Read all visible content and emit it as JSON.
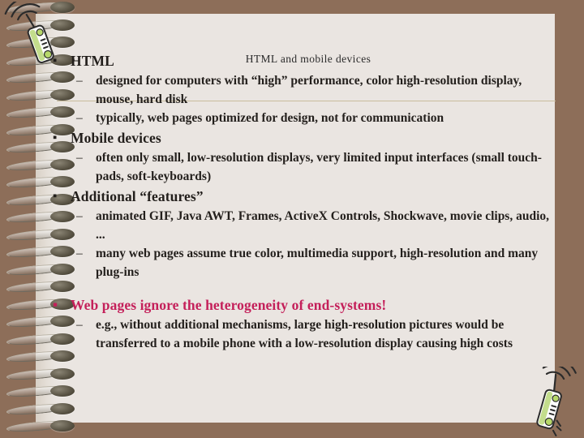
{
  "slide": {
    "title": "HTML and mobile devices",
    "colors": {
      "page_background": "#EAE5E1",
      "border_brown": "#8D6E59",
      "body_text": "#231F1C",
      "accent_text": "#C4205A",
      "rule": "#C9BC9C"
    },
    "markers": {
      "level1": "▪",
      "level2": "–"
    },
    "bullets": [
      {
        "level": 1,
        "text": "HTML",
        "accent": false
      },
      {
        "level": 2,
        "text": "designed for computers with “high” performance, color high-resolution display, mouse, hard disk",
        "accent": false
      },
      {
        "level": 2,
        "text": "typically, web pages optimized for design, not for communication",
        "accent": false
      },
      {
        "level": 1,
        "text": "Mobile devices",
        "accent": false
      },
      {
        "level": 2,
        "text": "often only small, low-resolution displays, very limited input interfaces (small touch-pads, soft-keyboards)",
        "accent": false
      },
      {
        "level": 1,
        "text": "Additional “features”",
        "accent": false
      },
      {
        "level": 2,
        "text": "animated GIF, Java AWT, Frames, ActiveX Controls, Shockwave, movie clips, audio, ...",
        "accent": false
      },
      {
        "level": 2,
        "text": "many web pages assume true color, multimedia support, high-resolution and many plug-ins",
        "accent": false
      },
      {
        "level": 1,
        "text": "Web pages ignore the heterogeneity of end-systems!",
        "accent": true
      },
      {
        "level": 2,
        "text": "e.g., without additional mechanisms, large high-resolution pictures would be transferred to a mobile phone with a low-resolution display causing high costs",
        "accent": false
      }
    ],
    "decorations": {
      "phone_top_left": "mobile-phone-icon",
      "phone_bottom_right": "mobile-phone-icon",
      "binding": "spiral-binding"
    }
  }
}
